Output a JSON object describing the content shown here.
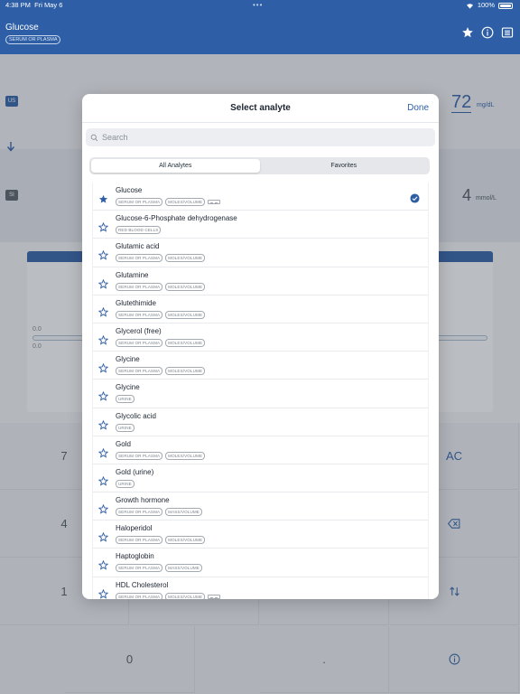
{
  "status_bar": {
    "time": "4:38 PM",
    "date": "Fri May 6",
    "battery": "100%"
  },
  "header": {
    "title": "Glucose",
    "chip": "SERUM OR PLASMA",
    "icons": [
      "star-icon",
      "info-icon",
      "list-icon"
    ]
  },
  "background": {
    "us_label": "US",
    "si_label": "SI",
    "us_value": "72",
    "us_unit": "mg/dL",
    "si_value": "4",
    "si_unit": "mmol/L",
    "chart_label_1": "0.0",
    "chart_label_2": "0.0",
    "keys": [
      "7",
      "AC",
      "4",
      "1",
      "0",
      "."
    ]
  },
  "modal": {
    "title": "Select analyte",
    "done_label": "Done",
    "search_placeholder": "Search",
    "segments": [
      "All Analytes",
      "Favorites"
    ],
    "active_segment": "All Analytes",
    "items": [
      {
        "name": "Glucose",
        "tags": [
          "SERUM OR PLASMA",
          "MOLES/VOLUME"
        ],
        "favorite": true,
        "selected": true,
        "ruler": true
      },
      {
        "name": "Glucose-6-Phosphate dehydrogenase",
        "tags": [
          "RED BLOOD CELLS"
        ],
        "favorite": false
      },
      {
        "name": "Glutamic acid",
        "tags": [
          "SERUM OR PLASMA",
          "MOLES/VOLUME"
        ],
        "favorite": false
      },
      {
        "name": "Glutamine",
        "tags": [
          "SERUM OR PLASMA",
          "MOLES/VOLUME"
        ],
        "favorite": false
      },
      {
        "name": "Glutethimide",
        "tags": [
          "SERUM OR PLASMA",
          "MOLES/VOLUME"
        ],
        "favorite": false
      },
      {
        "name": "Glycerol (free)",
        "tags": [
          "SERUM OR PLASMA",
          "MOLES/VOLUME"
        ],
        "favorite": false
      },
      {
        "name": "Glycine",
        "tags": [
          "SERUM OR PLASMA",
          "MOLES/VOLUME"
        ],
        "favorite": false
      },
      {
        "name": "Glycine",
        "tags": [
          "URINE"
        ],
        "favorite": false
      },
      {
        "name": "Glycolic acid",
        "tags": [
          "URINE"
        ],
        "favorite": false
      },
      {
        "name": "Gold",
        "tags": [
          "SERUM OR PLASMA",
          "MOLES/VOLUME"
        ],
        "favorite": false
      },
      {
        "name": "Gold (urine)",
        "tags": [
          "URINE"
        ],
        "favorite": false
      },
      {
        "name": "Growth hormone",
        "tags": [
          "SERUM OR PLASMA",
          "MASS/VOLUME"
        ],
        "favorite": false
      },
      {
        "name": "Haloperidol",
        "tags": [
          "SERUM OR PLASMA",
          "MOLES/VOLUME"
        ],
        "favorite": false
      },
      {
        "name": "Haptoglobin",
        "tags": [
          "SERUM OR PLASMA",
          "MASS/VOLUME"
        ],
        "favorite": false
      },
      {
        "name": "HDL Cholesterol",
        "tags": [
          "SERUM OR PLASMA",
          "MOLES/VOLUME"
        ],
        "favorite": false,
        "ruler": true
      }
    ]
  },
  "colors": {
    "accent": "#2e5fa6",
    "header_bg": "#2e5fa6"
  }
}
